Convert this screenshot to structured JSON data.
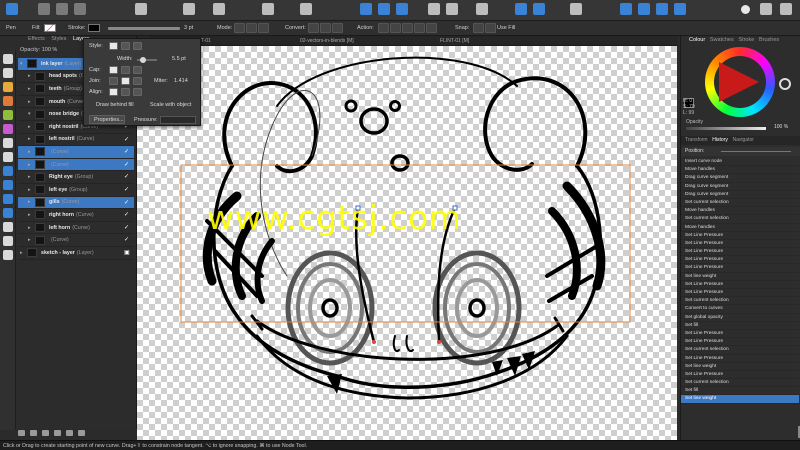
{
  "context_toolbar": {
    "tool": "Pen",
    "fill_label": "Fill:",
    "stroke_label": "Stroke:",
    "stroke_width": "3 pt",
    "mode_label": "Mode:",
    "convert_label": "Convert:",
    "action_label": "Action:",
    "snap_label": "Snap:",
    "use_fill": "Use Fill"
  },
  "doc_tabs": [
    "FLINT-01",
    "02-vectors-in-blends [M]",
    "FLINT-01 [M]"
  ],
  "left_panel": {
    "tabs": [
      "Effects",
      "Styles",
      "Layers"
    ],
    "active_tab": "Layers",
    "opacity_label": "Opacity:",
    "opacity_value": "100 %"
  },
  "layers": [
    {
      "name": "ink layer",
      "type": "(Layer)",
      "selected": true,
      "checked": true,
      "expanded": true
    },
    {
      "name": "head spots",
      "type": "(Group)",
      "selected": false,
      "checked": true,
      "expanded": false
    },
    {
      "name": "teeth",
      "type": "(Group)",
      "selected": false,
      "checked": true,
      "expanded": false
    },
    {
      "name": "mouth",
      "type": "(Curve)",
      "selected": false,
      "checked": true,
      "expanded": false
    },
    {
      "name": "nose bridge",
      "type": "(Group)",
      "selected": false,
      "checked": true,
      "expanded": true
    },
    {
      "name": "right nostril",
      "type": "(Curve)",
      "selected": false,
      "checked": true,
      "expanded": false
    },
    {
      "name": "left nostril",
      "type": "(Curve)",
      "selected": false,
      "checked": true,
      "expanded": false
    },
    {
      "name": "",
      "type": "(Curve)",
      "selected": true,
      "checked": true,
      "expanded": false
    },
    {
      "name": "",
      "type": "(Curve)",
      "selected": true,
      "checked": true,
      "expanded": false
    },
    {
      "name": "Right eye",
      "type": "(Group)",
      "selected": false,
      "checked": true,
      "expanded": false
    },
    {
      "name": "left eye",
      "type": "(Group)",
      "selected": false,
      "checked": true,
      "expanded": false
    },
    {
      "name": "gills",
      "type": "(Curve)",
      "selected": true,
      "checked": true,
      "expanded": false
    },
    {
      "name": "right horn",
      "type": "(Curve)",
      "selected": false,
      "checked": true,
      "expanded": false
    },
    {
      "name": "left horn",
      "type": "(Curve)",
      "selected": false,
      "checked": true,
      "expanded": false
    },
    {
      "name": "",
      "type": "(Curve)",
      "selected": false,
      "checked": true,
      "expanded": false
    },
    {
      "name": "sketch - layer",
      "type": "(Layer)",
      "selected": false,
      "checked": false,
      "expanded": false
    }
  ],
  "stroke_popup": {
    "style_label": "Style:",
    "width_label": "Width:",
    "width_value": "5.5 pt",
    "width_fraction": 0.3,
    "cap_label": "Cap:",
    "join_label": "Join:",
    "miter_label": "Miter:",
    "miter_value": "1.414",
    "align_label": "Align:",
    "draw_behind": "Draw behind fill",
    "scale_with_object": "Scale with object",
    "properties_button": "Properties...",
    "pressure_label": "Pressure:"
  },
  "watermark": "www.cgtsj.com",
  "right_panel": {
    "tabs": [
      "Colour",
      "Swatches",
      "Stroke",
      "Brushes"
    ],
    "active_tab": "Colour",
    "hsl": [
      "H: 0",
      "S: 70",
      "L: 99"
    ],
    "opacity_label": "Opacity",
    "opacity_value": "100 %",
    "lower_tabs": [
      "Transform",
      "History",
      "Navigator"
    ],
    "active_lower_tab": "History",
    "position_label": "Position:"
  },
  "history": [
    "Insert curve node",
    "Move handles",
    "Drag curve segment",
    "Drag curve segment",
    "Drag curve segment",
    "Set current selection",
    "Move handles",
    "Set current selection",
    "Move handles",
    "Set Line Pressure",
    "Set Line Pressure",
    "Set Line Pressure",
    "Set Line Pressure",
    "Set Line Pressure",
    "Set line weight",
    "Set Line Pressure",
    "Set Line Pressure",
    "Set current selection",
    "Convert to curves",
    "Set global opacity",
    "Set fill",
    "Set Line Pressure",
    "Set Line Pressure",
    "Set current selection",
    "Set Line Pressure",
    "Set line weight",
    "Set Line Pressure",
    "Set current selection",
    "Set fill",
    "Set line weight"
  ],
  "history_selected_index": 29,
  "status_bar": "Click or Drag to create starting point of new curve. Drag+⇧ to constrain node tangent. ⌥ to ignore snapping. ⌘ to use Node Tool.",
  "colors": {
    "accent": "#3d78c2",
    "selection_box": "#e0883c",
    "watermark": "#ffff00"
  }
}
